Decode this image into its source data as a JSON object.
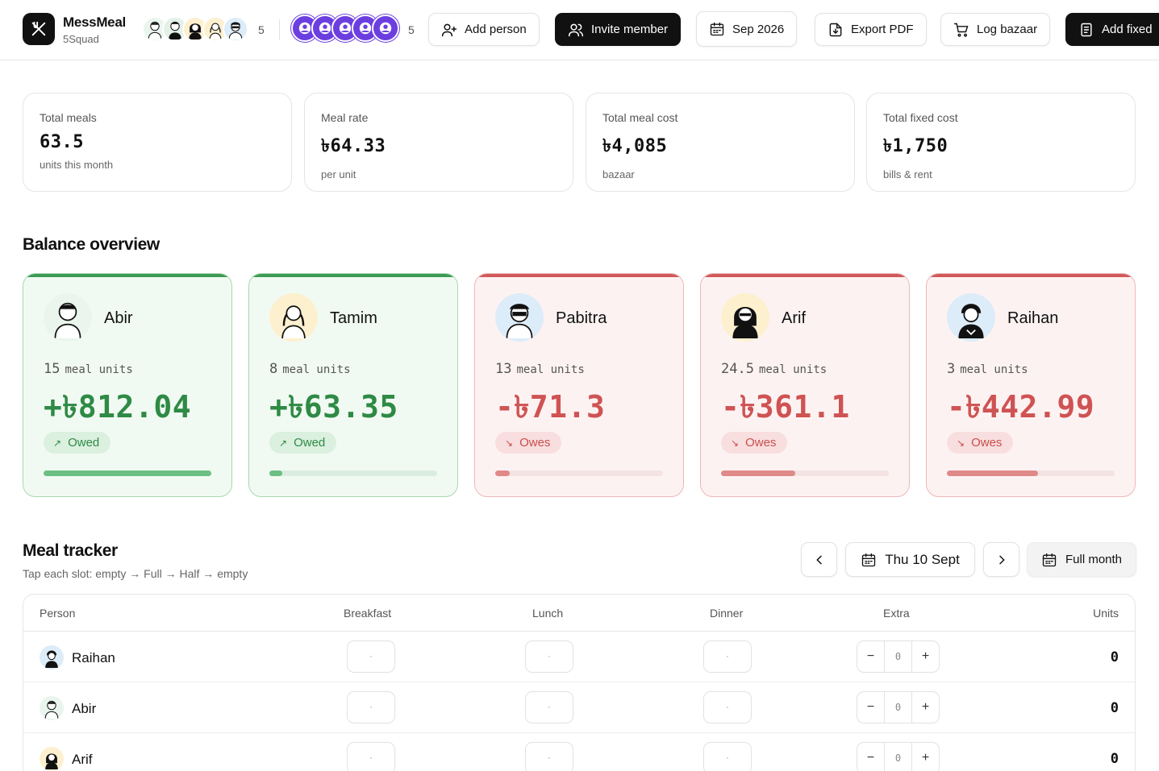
{
  "brand": {
    "name": "MessMeal",
    "sub": "5Squad"
  },
  "header": {
    "member_count": "5",
    "invite_count": "5",
    "buttons": {
      "add_person": "Add person",
      "invite_member": "Invite member",
      "month": "Sep 2026",
      "export": "Export PDF",
      "log_bazaar": "Log bazaar",
      "add_fixed": "Add fixed"
    }
  },
  "stats": [
    {
      "label": "Total meals",
      "value": "63.5",
      "sub": "units this month"
    },
    {
      "label": "Meal rate",
      "value": "৳64.33",
      "sub": "per unit"
    },
    {
      "label": "Total meal cost",
      "value": "৳4,085",
      "sub": "bazaar"
    },
    {
      "label": "Total fixed cost",
      "value": "৳1,750",
      "sub": "bills & rent"
    }
  ],
  "balance": {
    "title": "Balance overview",
    "units_label": "meal units",
    "members": [
      {
        "name": "Abir",
        "units": "15",
        "amount": "+৳812.04",
        "status": "Owed",
        "arrow": "↗",
        "bar": 1.0,
        "avatar_bg": "#eaf6ed"
      },
      {
        "name": "Tamim",
        "units": "8",
        "amount": "+৳63.35",
        "status": "Owed",
        "arrow": "↗",
        "bar": 0.078,
        "avatar_bg": "#fdf0cf"
      },
      {
        "name": "Pabitra",
        "units": "13",
        "amount": "-৳71.3",
        "status": "Owes",
        "arrow": "↘",
        "bar": 0.088,
        "avatar_bg": "#dcecf8"
      },
      {
        "name": "Arif",
        "units": "24.5",
        "amount": "-৳361.1",
        "status": "Owes",
        "arrow": "↘",
        "bar": 0.444,
        "avatar_bg": "#fdf0cf"
      },
      {
        "name": "Raihan",
        "units": "3",
        "amount": "-৳442.99",
        "status": "Owes",
        "arrow": "↘",
        "bar": 0.545,
        "avatar_bg": "#dcecf8"
      }
    ]
  },
  "tracker": {
    "title": "Meal tracker",
    "subtitle": "Tap each slot: empty → Full → Half → empty",
    "date": "Thu 10 Sept",
    "full_month": "Full month",
    "columns": [
      "Person",
      "Breakfast",
      "Lunch",
      "Dinner",
      "Extra",
      "Units"
    ],
    "empty_slot": "·",
    "rows": [
      {
        "name": "Raihan",
        "extra": "0",
        "units": "0",
        "avatar_bg": "#dcecf8"
      },
      {
        "name": "Abir",
        "extra": "0",
        "units": "0",
        "avatar_bg": "#eaf6ed"
      },
      {
        "name": "Arif",
        "extra": "0",
        "units": "0",
        "avatar_bg": "#fdf0cf"
      }
    ],
    "minus": "−",
    "plus": "+"
  },
  "colors": {
    "accent_dark": "#111111",
    "owed": "#2e8a45",
    "owes": "#cf5353",
    "invite": "#6b3ee0"
  },
  "icons": [
    "utensils-icon",
    "user-plus-icon",
    "users-icon",
    "calendar-icon",
    "file-download-icon",
    "cart-icon",
    "receipt-icon",
    "chevron-left-icon",
    "chevron-right-icon"
  ]
}
